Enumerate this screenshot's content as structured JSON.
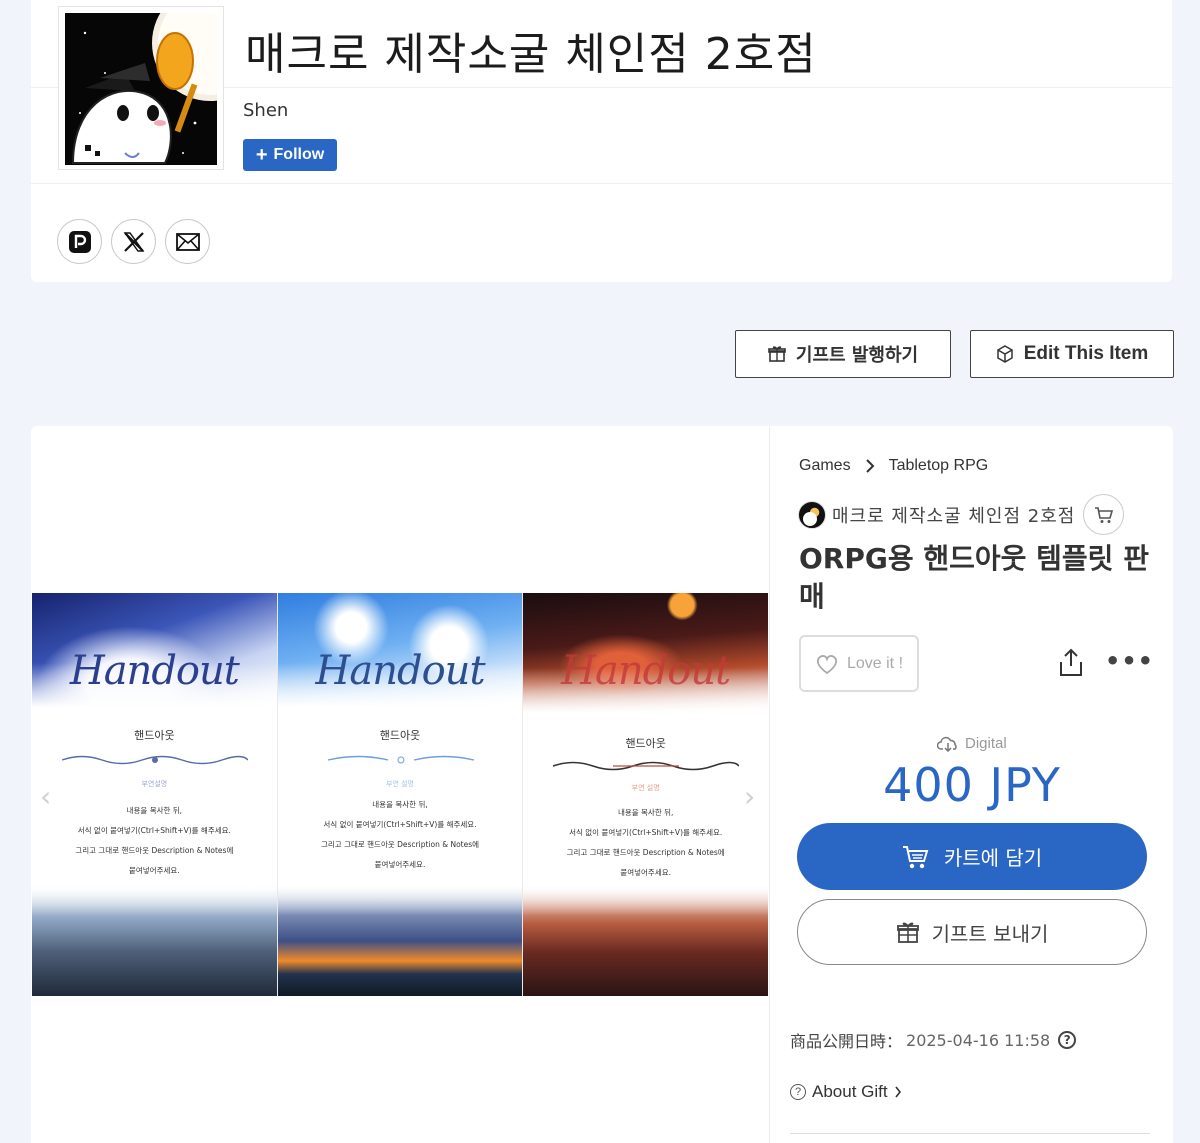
{
  "shop": {
    "title": "매크로 제작소굴 체인점 2호점",
    "owner": "Shen",
    "follow_label": "Follow",
    "social_icons": [
      "pixiv-icon",
      "x-icon",
      "mail-icon"
    ]
  },
  "actions": {
    "gift_issue_label": "기프트 발행하기",
    "edit_label": "Edit This Item"
  },
  "gallery": {
    "panels": [
      {
        "script": "Handout",
        "title": "핸드아웃",
        "subtitle": "부연설명",
        "lines": [
          "내용을 복사한 뒤,",
          "서식 없이 붙여넣기(Ctrl+Shift+V)를 해주세요.",
          "그리고 그대로 핸드아웃 Description & Notes에",
          "붙여넣어주세요."
        ]
      },
      {
        "script": "Handout",
        "title": "핸드아웃",
        "subtitle": "부연 설명",
        "lines": [
          "내용을 복사한 뒤,",
          "서식 없이 붙여넣기(Ctrl+Shift+V)를 해주세요.",
          "그리고 그대로 핸드아웃 Description & Notes에",
          "붙여넣어주세요."
        ]
      },
      {
        "script": "Handout",
        "title": "핸드아웃",
        "subtitle": "부연 설명",
        "lines": [
          "내용을 복사한 뒤,",
          "서식 없이 붙여넣기(Ctrl+Shift+V)를 해주세요.",
          "그리고 그대로 핸드아웃 Description & Notes에",
          "붙여넣어주세요."
        ]
      }
    ]
  },
  "item": {
    "breadcrumb": [
      "Games",
      "Tabletop RPG"
    ],
    "shop_name": "매크로 제작소굴 체인점 2호점",
    "title": "ORPG용 핸드아웃 템플릿 판매",
    "love_label": "Love it !",
    "delivery_type": "Digital",
    "price": "400 JPY",
    "cart_label": "카트에 담기",
    "gift_label": "기프트 보내기",
    "published_label": "商品公開日時：",
    "published_value": "2025-04-16 11:58",
    "about_gift_label": "About Gift"
  },
  "colors": {
    "accent": "#2a66c4",
    "page_bg": "#f1f5fb"
  }
}
